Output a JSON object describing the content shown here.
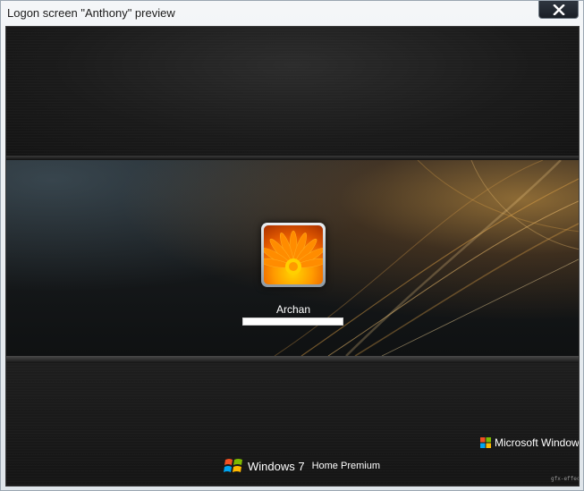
{
  "window": {
    "title": "Logon screen \"Anthony\" preview",
    "close_icon": "close-icon"
  },
  "logon": {
    "user_name": "Archan",
    "password_value": "",
    "user_picture": "orange-flower-picture"
  },
  "branding": {
    "microsoft": "Microsoft Windows",
    "windows7_name": "Windows 7",
    "windows7_edition": "Home Premium",
    "flag_icon": "windows-flag-icon"
  },
  "watermark": "gfx-effect",
  "colors": {
    "accent_swoosh": "#e8a84a",
    "background": "#1b1b1b",
    "titlebar": "#f4f6f8"
  }
}
